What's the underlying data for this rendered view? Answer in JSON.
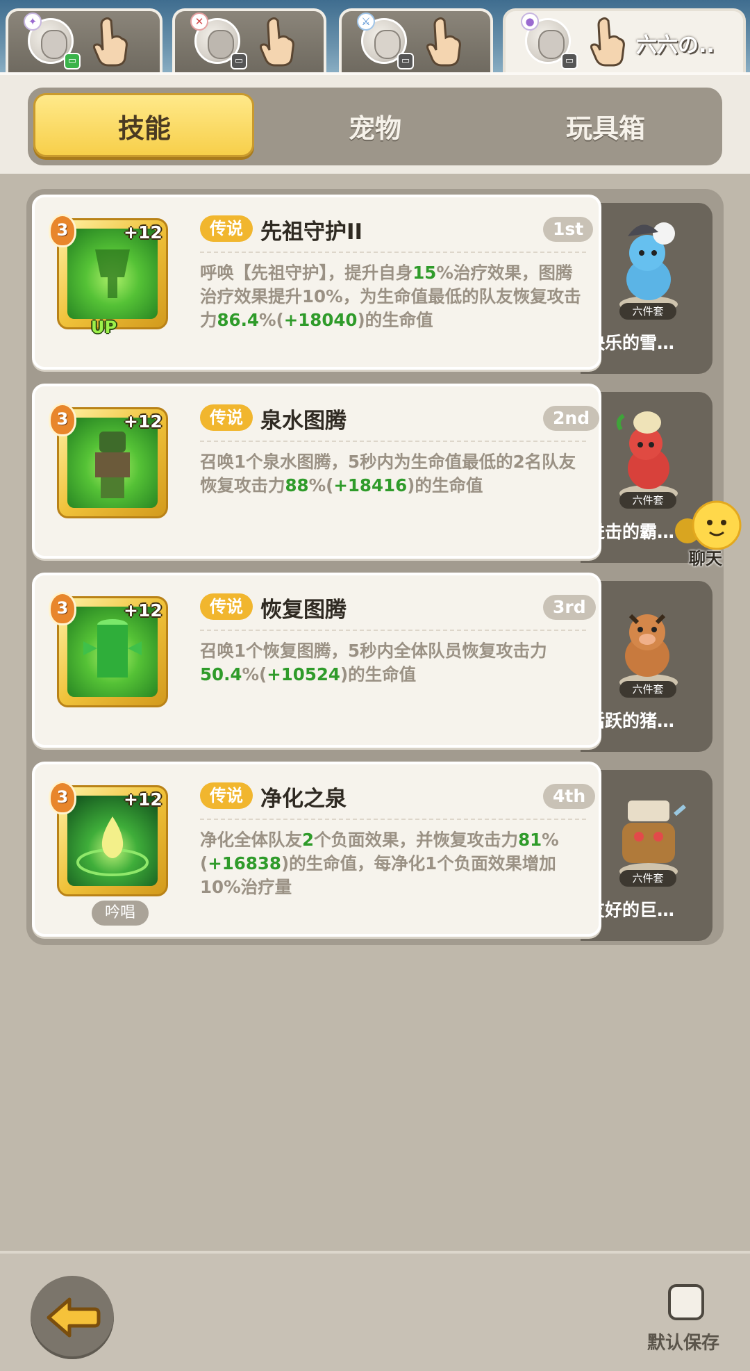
{
  "character_tabs": [
    {
      "name": "",
      "class_icon": "wing-badge-icon",
      "status": "green"
    },
    {
      "name": "",
      "class_icon": "x-badge-icon",
      "status": "gray"
    },
    {
      "name": "",
      "class_icon": "sword-badge-icon",
      "status": "gray"
    },
    {
      "name": "六六の..",
      "class_icon": "orb-badge-icon",
      "status": "gray"
    }
  ],
  "category_tabs": [
    "技能",
    "宠物",
    "玩具箱"
  ],
  "skills": [
    {
      "level": "3",
      "plus": "+12",
      "rarity": "传说",
      "name": "先祖守护II",
      "order": "1st",
      "up_tag": "UP",
      "desc": [
        {
          "t": "呼唤【先祖守护】，提升自身"
        },
        {
          "t": "15",
          "h": true
        },
        {
          "t": "%治疗效果，图腾治疗效果提升10%，为生命值最低的队友恢复攻击力"
        },
        {
          "t": "86.4",
          "h": true
        },
        {
          "t": "%("
        },
        {
          "t": "+18040",
          "h": true
        },
        {
          "t": ")的生命值"
        }
      ],
      "pet_name": "快乐的雪…",
      "set_label": "六件套"
    },
    {
      "level": "3",
      "plus": "+12",
      "rarity": "传说",
      "name": "泉水图腾",
      "order": "2nd",
      "desc": [
        {
          "t": "召唤1个泉水图腾，5秒内为生命值最低的2名队友恢复攻击力"
        },
        {
          "t": "88",
          "h": true
        },
        {
          "t": "%("
        },
        {
          "t": "+18416",
          "h": true
        },
        {
          "t": ")的生命值"
        }
      ],
      "pet_name": "进击的霸…",
      "set_label": "六件套"
    },
    {
      "level": "3",
      "plus": "+12",
      "rarity": "传说",
      "name": "恢复图腾",
      "order": "3rd",
      "desc": [
        {
          "t": "召唤1个恢复图腾，5秒内全体队员恢复攻击力"
        },
        {
          "t": "50.4",
          "h": true
        },
        {
          "t": "%("
        },
        {
          "t": "+10524",
          "h": true
        },
        {
          "t": ")的生命值"
        }
      ],
      "pet_name": "活跃的猪…",
      "set_label": "六件套"
    },
    {
      "level": "3",
      "plus": "+12",
      "rarity": "传说",
      "name": "净化之泉",
      "order": "4th",
      "chant": "吟唱",
      "desc": [
        {
          "t": "净化全体队友"
        },
        {
          "t": "2",
          "h": true
        },
        {
          "t": "个负面效果，并恢复攻击力"
        },
        {
          "t": "81",
          "h": true
        },
        {
          "t": "%("
        },
        {
          "t": "+16838",
          "h": true
        },
        {
          "t": ")的生命值，每净化1个负面效果增加10%治疗量"
        }
      ],
      "pet_name": "友好的巨…",
      "set_label": "六件套"
    }
  ],
  "chat": {
    "label": "聊天"
  },
  "footer": {
    "default_save_label": "默认保存"
  },
  "colors": {
    "highlight_green": "#2f9b2a",
    "rarity_gold": "#f1b62e",
    "tab_active": "#f7cf4a"
  }
}
